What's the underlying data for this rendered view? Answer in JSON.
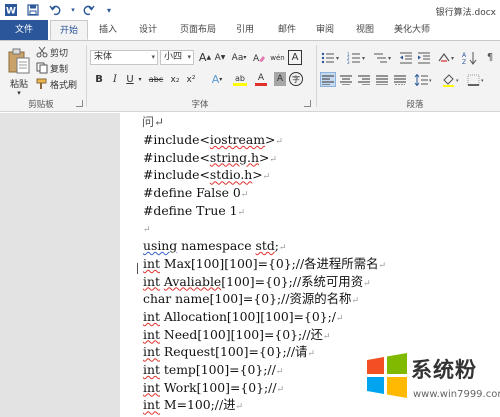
{
  "titlebar": {
    "doc_title": "银行算法.docx"
  },
  "tabs": [
    {
      "label": "文件"
    },
    {
      "label": "开始"
    },
    {
      "label": "插入"
    },
    {
      "label": "设计"
    },
    {
      "label": "页面布局"
    },
    {
      "label": "引用"
    },
    {
      "label": "邮件"
    },
    {
      "label": "审阅"
    },
    {
      "label": "视图"
    },
    {
      "label": "美化大师"
    }
  ],
  "clipboard": {
    "paste": "粘贴",
    "cut": "剪切",
    "copy": "复制",
    "format_painter": "格式刷",
    "group_label": "剪贴板"
  },
  "font": {
    "name": "宋体",
    "size": "小四",
    "grow": "A",
    "shrink": "A",
    "case": "Aa",
    "clear_format": "wén",
    "phonetic": "A",
    "bold": "B",
    "italic": "I",
    "underline": "U",
    "strike": "abc",
    "subscript": "x₂",
    "superscript": "x²",
    "effects": "A",
    "highlight": "ab",
    "color": "A",
    "shade": "A",
    "enclose": "字",
    "group_label": "字体"
  },
  "paragraph": {
    "group_label": "段落"
  },
  "document": {
    "top_fragment": "问↵",
    "lines": [
      {
        "parts": [
          [
            "#include",
            ""
          ],
          [
            "<",
            ""
          ],
          [
            "iostream",
            "sq"
          ],
          [
            ">",
            ""
          ]
        ]
      },
      {
        "parts": [
          [
            "#include",
            ""
          ],
          [
            "<",
            ""
          ],
          [
            "string.h",
            "sq"
          ],
          [
            ">",
            ""
          ]
        ]
      },
      {
        "parts": [
          [
            "#include",
            ""
          ],
          [
            "<",
            ""
          ],
          [
            "stdio.h",
            "sq"
          ],
          [
            ">",
            ""
          ]
        ]
      },
      {
        "parts": [
          [
            "#define False 0",
            ""
          ]
        ]
      },
      {
        "parts": [
          [
            "#define True 1",
            ""
          ]
        ]
      },
      {
        "parts": [
          [
            "",
            ""
          ]
        ]
      },
      {
        "parts": [
          [
            "using",
            "sqb"
          ],
          [
            " namespace ",
            ""
          ],
          [
            "std",
            "sq"
          ],
          [
            ";",
            ""
          ]
        ]
      },
      {
        "parts": [
          [
            "int",
            "sq"
          ],
          [
            " Max[100][100]={0};//各进程所需名",
            ""
          ]
        ]
      },
      {
        "parts": [
          [
            "int",
            "sq"
          ],
          [
            " ",
            ""
          ],
          [
            "Avaliable",
            "sq"
          ],
          [
            "[100]={0};//系统可用资",
            ""
          ]
        ]
      },
      {
        "parts": [
          [
            "char name[100]={0};//资源的名称",
            ""
          ]
        ]
      },
      {
        "parts": [
          [
            "int",
            "sq"
          ],
          [
            " Allocation[100][100]={0};/",
            ""
          ]
        ]
      },
      {
        "parts": [
          [
            "int",
            "sq"
          ],
          [
            " Need[100][100]={0};//还",
            ""
          ]
        ]
      },
      {
        "parts": [
          [
            "int",
            "sq"
          ],
          [
            " Request[100]={0};//请",
            ""
          ]
        ]
      },
      {
        "parts": [
          [
            "int",
            "sq"
          ],
          [
            " temp[100]={0};//",
            ""
          ]
        ]
      },
      {
        "parts": [
          [
            "int",
            "sq"
          ],
          [
            " Work[100]={0};//",
            ""
          ]
        ]
      },
      {
        "parts": [
          [
            "int",
            "sq"
          ],
          [
            " M=100;//进",
            ""
          ]
        ]
      }
    ]
  },
  "watermark": {
    "name": "系统粉",
    "url": "www.win7999.com"
  },
  "colors": {
    "accent": "#2b579a",
    "ribbon_bg": "#f3f3f3",
    "workspace": "#e3e3e3",
    "spell_error": "#e0312b",
    "grammar_error": "#3a5fcd",
    "highlight_yellow": "#ffff00",
    "font_red": "#e0312b"
  }
}
